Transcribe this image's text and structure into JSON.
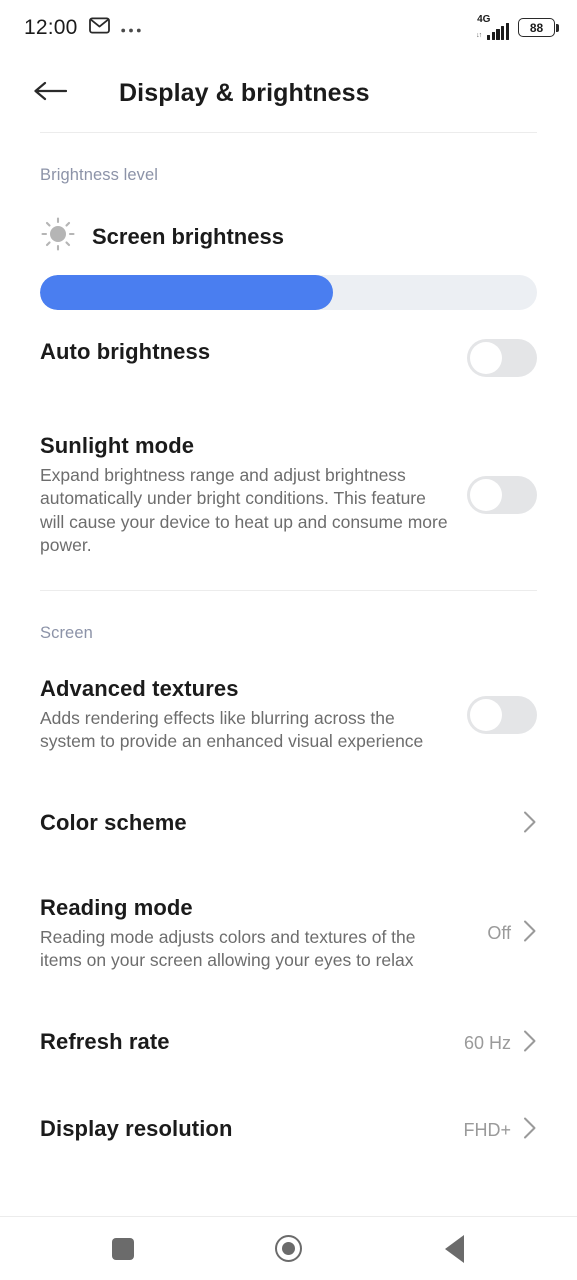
{
  "status_bar": {
    "clock": "12:00",
    "notification_icons": [
      "gmail-icon",
      "more-notifications-dots"
    ],
    "network_type": "4G",
    "data_arrows": "↓↑",
    "signal_bars": 5,
    "battery_level": "88"
  },
  "app_bar": {
    "back_icon": "back-arrow-icon",
    "title": "Display & brightness"
  },
  "sections": [
    {
      "label": "Brightness level"
    },
    {
      "label": "Screen"
    }
  ],
  "brightness": {
    "icon": "sun-icon",
    "title": "Screen brightness",
    "slider_percent": 59
  },
  "rows": {
    "auto_brightness": {
      "title": "Auto brightness",
      "toggle_on": false
    },
    "sunlight_mode": {
      "title": "Sunlight mode",
      "description": "Expand brightness range and adjust brightness automatically under bright conditions. This feature will cause your device to heat up and consume more power.",
      "toggle_on": false
    },
    "advanced_textures": {
      "title": "Advanced textures",
      "description": "Adds rendering effects like blurring across the system to provide an enhanced visual experience",
      "toggle_on": false
    },
    "color_scheme": {
      "title": "Color scheme",
      "value": "",
      "chevron": "chevron-right-icon"
    },
    "reading_mode": {
      "title": "Reading mode",
      "description": "Reading mode adjusts colors and textures of the items on your screen allowing your eyes to relax",
      "value": "Off",
      "chevron": "chevron-right-icon"
    },
    "refresh_rate": {
      "title": "Refresh rate",
      "value": "60 Hz",
      "chevron": "chevron-right-icon"
    },
    "display_resolution": {
      "title": "Display resolution",
      "value": "FHD+",
      "chevron": "chevron-right-icon"
    }
  },
  "nav_bar": {
    "recents": "recents-square-icon",
    "home": "home-circle-icon",
    "back": "back-triangle-icon"
  },
  "colors": {
    "accent": "#4a7ef0",
    "slider_track": "#eceff3",
    "toggle_track": "#e4e5e7",
    "section_label": "#8c93a8",
    "title": "#1b1b1b",
    "description": "#6d6d6d",
    "value": "#9a9a9a",
    "divider": "#ececec",
    "nav_icon": "#6b6b6b"
  }
}
